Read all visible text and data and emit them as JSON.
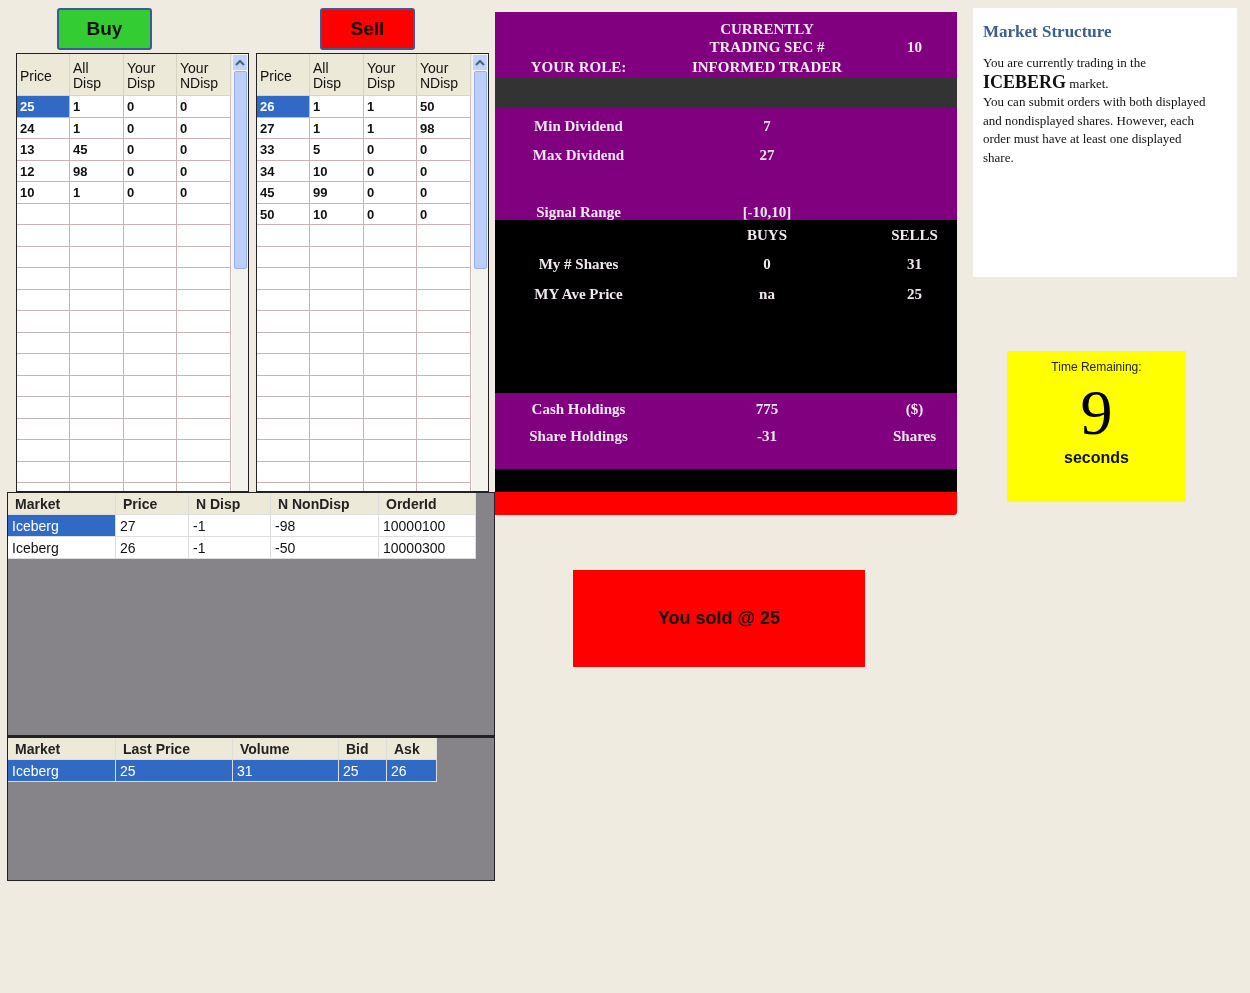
{
  "buy_button": "Buy",
  "sell_button": "Sell",
  "buy_book": {
    "columns": [
      "Price",
      "All Disp",
      "Your Disp",
      "Your NDisp"
    ],
    "rows": [
      {
        "cells": [
          "25",
          "1",
          "0",
          "0"
        ],
        "selected": true
      },
      {
        "cells": [
          "24",
          "1",
          "0",
          "0"
        ],
        "selected": false
      },
      {
        "cells": [
          "13",
          "45",
          "0",
          "0"
        ],
        "selected": false
      },
      {
        "cells": [
          "12",
          "98",
          "0",
          "0"
        ],
        "selected": false
      },
      {
        "cells": [
          "10",
          "1",
          "0",
          "0"
        ],
        "selected": false
      }
    ]
  },
  "sell_book": {
    "columns": [
      "Price",
      "All Disp",
      "Your Disp",
      "Your NDisp"
    ],
    "rows": [
      {
        "cells": [
          "26",
          "1",
          "1",
          "50"
        ],
        "selected": true
      },
      {
        "cells": [
          "27",
          "1",
          "1",
          "98"
        ],
        "selected": false
      },
      {
        "cells": [
          "33",
          "5",
          "0",
          "0"
        ],
        "selected": false
      },
      {
        "cells": [
          "34",
          "10",
          "0",
          "0"
        ],
        "selected": false
      },
      {
        "cells": [
          "45",
          "99",
          "0",
          "0"
        ],
        "selected": false
      },
      {
        "cells": [
          "50",
          "10",
          "0",
          "0"
        ],
        "selected": false
      }
    ]
  },
  "orders": {
    "columns": [
      "Market",
      "Price",
      "N Disp",
      "N NonDisp",
      "OrderId"
    ],
    "rows": [
      {
        "cells": [
          "Iceberg",
          "27",
          "-1",
          "-98",
          "10000100"
        ],
        "selected": true
      },
      {
        "cells": [
          "Iceberg",
          "26",
          "-1",
          "-50",
          "10000300"
        ],
        "selected": false
      }
    ]
  },
  "markets": {
    "columns": [
      "Market",
      "Last Price",
      "Volume",
      "Bid",
      "Ask"
    ],
    "rows": [
      {
        "cells": [
          "Iceberg",
          "25",
          "31",
          "25",
          "26"
        ],
        "selected": true
      }
    ]
  },
  "info": {
    "trading_sec_label": "CURRENTLY TRADING SEC #",
    "trading_sec": "10",
    "role_label": "YOUR ROLE:",
    "role": "INFORMED TRADER",
    "dividends": [
      {
        "label": "Min Dividend",
        "value": "7"
      },
      {
        "label": "Max Dividend",
        "value": "27"
      }
    ],
    "signal_label": "Signal Range",
    "signal": "[-10,10]",
    "position_columns": [
      "BUYS",
      "SELLS"
    ],
    "position_rows": [
      {
        "label": "My # Shares",
        "buys": "0",
        "sells": "31"
      },
      {
        "label": "MY Ave Price",
        "buys": "na",
        "sells": "25"
      }
    ],
    "holdings": [
      {
        "label": "Cash Holdings",
        "value": "775",
        "unit": "($)"
      },
      {
        "label": "Share Holdings",
        "value": "-31",
        "unit": "Shares"
      }
    ]
  },
  "market_structure": {
    "title": "Market Structure",
    "paragraphs": [
      "You are currently trading in the **ICEBERG** market.",
      "You can submit orders with both displayed and nondisplayed shares. However, each order must have at least one displayed share."
    ]
  },
  "timer": {
    "label": "Time Remaining:",
    "value": "9",
    "unit": "seconds"
  },
  "message": "You sold @ 25"
}
